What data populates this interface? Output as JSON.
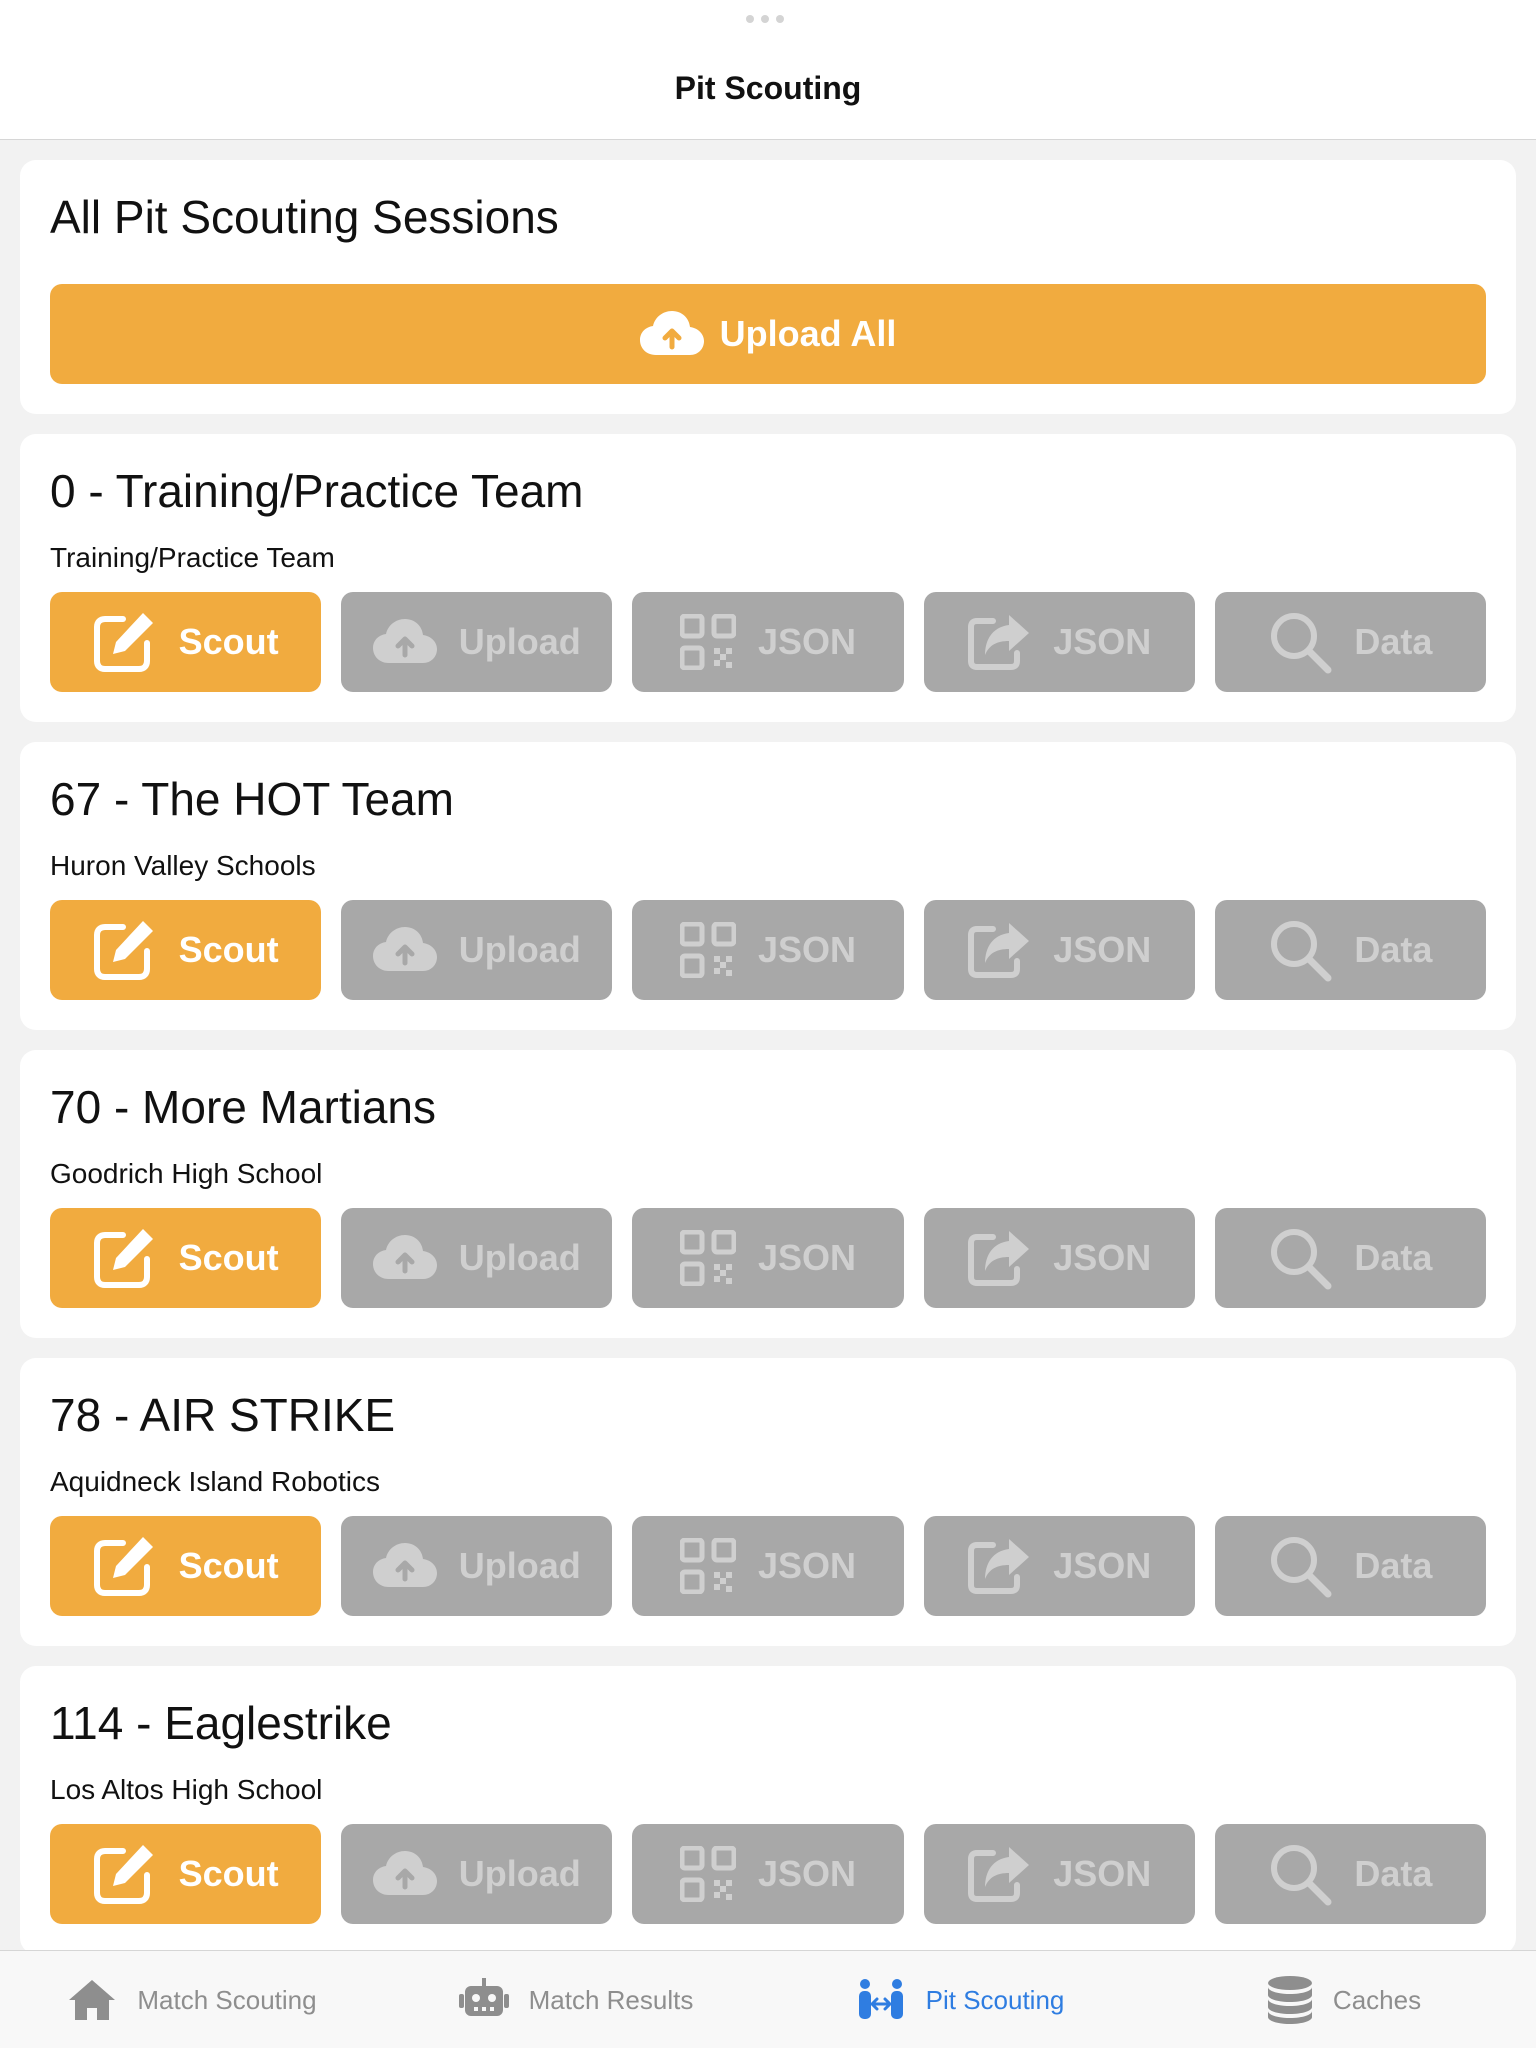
{
  "nav": {
    "title": "Pit Scouting"
  },
  "summary": {
    "title": "All Pit Scouting Sessions",
    "upload_all_label": "Upload All"
  },
  "teams": [
    {
      "title": "0 - Training/Practice Team",
      "subtitle": "Training/Practice Team"
    },
    {
      "title": "67 - The HOT Team",
      "subtitle": "Huron Valley Schools"
    },
    {
      "title": "70 - More Martians",
      "subtitle": "Goodrich High School"
    },
    {
      "title": "78 - AIR STRIKE",
      "subtitle": "Aquidneck Island Robotics"
    },
    {
      "title": "114 - Eaglestrike",
      "subtitle": "Los Altos High School"
    }
  ],
  "actions": {
    "scout": "Scout",
    "upload": "Upload",
    "qr_json": "JSON",
    "share_json": "JSON",
    "data": "Data"
  },
  "tabs": [
    {
      "label": "Match Scouting",
      "icon": "house-icon"
    },
    {
      "label": "Match Results",
      "icon": "robot-icon"
    },
    {
      "label": "Pit Scouting",
      "icon": "people-arrows-icon",
      "active": true
    },
    {
      "label": "Caches",
      "icon": "database-icon"
    }
  ],
  "colors": {
    "accent": "#f1ab3f",
    "disabled": "#a8a8a8",
    "tab_active": "#2f7de1",
    "tab_inactive": "#8e8e8e"
  }
}
